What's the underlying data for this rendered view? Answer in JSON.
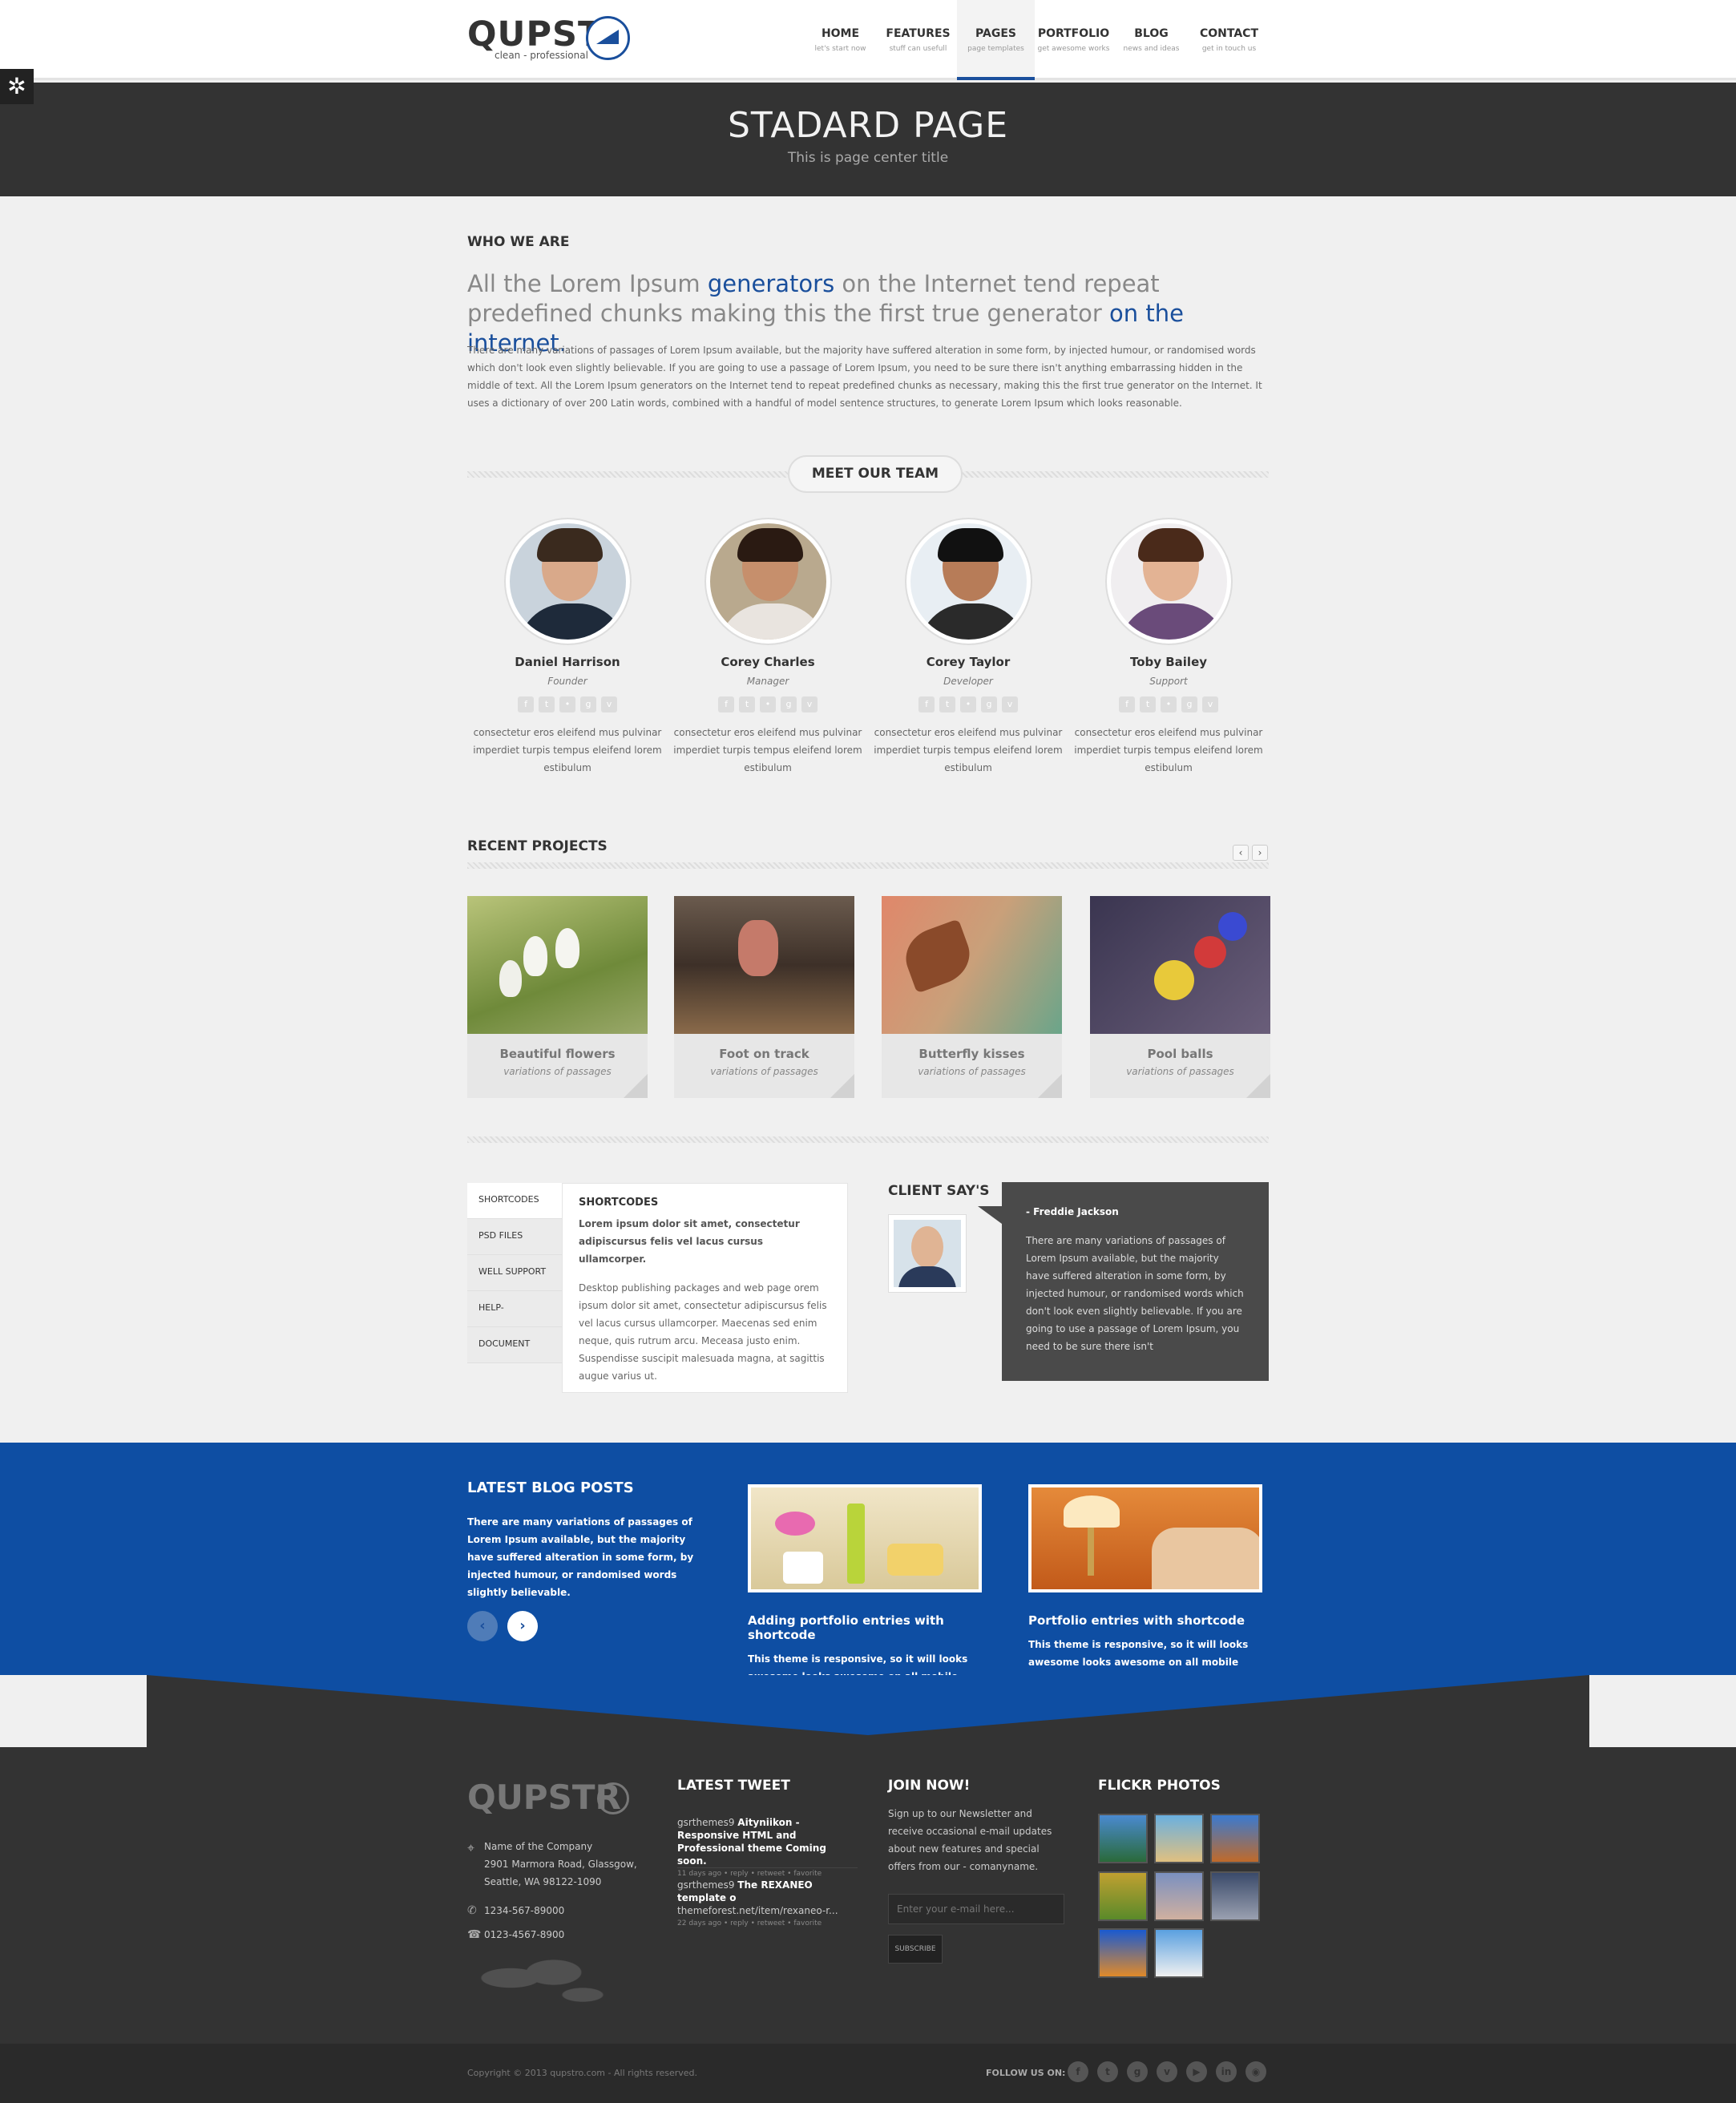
{
  "logo": {
    "word": "QUPSTR",
    "tagline": "clean - professional"
  },
  "nav": [
    {
      "label": "HOME",
      "sub": "let's start now"
    },
    {
      "label": "FEATURES",
      "sub": "stuff can usefull"
    },
    {
      "label": "PAGES",
      "sub": "page templates"
    },
    {
      "label": "PORTFOLIO",
      "sub": "get awesome works"
    },
    {
      "label": "BLOG",
      "sub": "news and ideas"
    },
    {
      "label": "CONTACT",
      "sub": "get in touch us"
    }
  ],
  "settings_icon": "gear-icon",
  "banner": {
    "title": "STADARD PAGE",
    "subtitle": "This is page center title"
  },
  "about": {
    "heading": "WHO WE ARE",
    "lead_1": "All the Lorem Ipsum ",
    "lead_hl1": "generators",
    "lead_2": " on the Internet tend repeat predefined chunks making this the first true generator ",
    "lead_hl2": "on the internet",
    "lead_3": ".",
    "paragraph": "There are many variations of passages of Lorem Ipsum available, but the majority have suffered alteration in some form, by injected humour, or randomised words which don't look even slightly believable. If you are going to use a passage of Lorem Ipsum, you need to be sure there isn't anything embarrassing hidden in the middle of text. All the Lorem Ipsum generators on the Internet tend to repeat predefined chunks as necessary, making this the first true generator on the Internet. It uses a dictionary of over 200 Latin words, combined with a handful of model sentence structures, to generate Lorem Ipsum which looks reasonable."
  },
  "team": {
    "heading": "MEET OUR TEAM",
    "members": [
      {
        "name": "Daniel Harrison",
        "role": "Founder",
        "desc": "consectetur eros eleifend mus pulvinar imperdiet turpis tempus eleifend lorem estibulum"
      },
      {
        "name": "Corey Charles",
        "role": "Manager",
        "desc": "consectetur eros eleifend mus pulvinar imperdiet turpis tempus eleifend lorem estibulum"
      },
      {
        "name": "Corey Taylor",
        "role": "Developer",
        "desc": "consectetur eros eleifend mus pulvinar imperdiet turpis tempus eleifend lorem estibulum"
      },
      {
        "name": "Toby Bailey",
        "role": "Support",
        "desc": "consectetur eros eleifend mus pulvinar imperdiet turpis tempus eleifend lorem estibulum"
      }
    ],
    "social_icons": [
      "facebook-icon",
      "twitter-icon",
      "flickr-icon",
      "google-plus-icon",
      "vimeo-icon"
    ]
  },
  "projects": {
    "heading": "RECENT PROJECTS",
    "prev": "‹",
    "next": "›",
    "items": [
      {
        "title": "Beautiful flowers",
        "sub": "variations of passages"
      },
      {
        "title": "Foot on track",
        "sub": "variations of passages"
      },
      {
        "title": "Butterfly kisses",
        "sub": "variations of passages"
      },
      {
        "title": "Pool balls",
        "sub": "variations of passages"
      }
    ]
  },
  "tabs": {
    "items": [
      "SHORTCODES",
      "PSD FILES",
      "WELL SUPPORT",
      "HELP-",
      "DOCUMENT"
    ],
    "content_title": "SHORTCODES",
    "content_bold": "Lorem ipsum dolor sit amet, consectetur adipiscursus felis vel lacus cursus ullamcorper.",
    "content_text": "Desktop publishing packages and web page orem ipsum dolor sit amet, consectetur adipiscursus felis vel lacus cursus ullamcorper. Maecenas sed enim neque, quis rutrum arcu. Meceasa justo enim. Suspendisse suscipit malesuada magna, at sagittis augue varius ut."
  },
  "client": {
    "heading": "CLIENT SAY'S",
    "author": "- Freddie Jackson",
    "quote": "There are many variations of passages of Lorem Ipsum available, but the majority have suffered alteration in some form, by injected humour, or randomised words which don't look even slightly believable. If you are going to use a passage of Lorem Ipsum, you need to be sure there isn't"
  },
  "blog": {
    "heading": "LATEST BLOG POSTS",
    "intro": "There are many variations of passages of Lorem Ipsum available, but the majority have suffered alteration in some form, by injected humour, or randomised words slightly believable.",
    "prev": "‹",
    "next": "›",
    "posts": [
      {
        "title": "Adding portfolio entries with shortcode",
        "desc": "This theme is responsive, so it will looks awesome looks awesome on all mobile devices."
      },
      {
        "title": "Portfolio entries with shortcode",
        "desc": "This theme is responsive, so it will looks awesome looks awesome on all mobile devices."
      }
    ]
  },
  "footer": {
    "logo": "QUPSTR",
    "company": "Name of the Company",
    "address1": "2901 Marmora Road, Glassgow,",
    "address2": "Seattle, WA 98122-1090",
    "phone": "1234-567-89000",
    "fax": "0123-4567-8900",
    "tweet_heading": "LATEST TWEET",
    "tweets": [
      {
        "user": "gsrthemes9",
        "text": "Aityniikon - Responsive HTML and Professional theme Coming soon.",
        "meta": "11 days ago • reply • retweet • favorite"
      },
      {
        "user": "gsrthemes9",
        "text": "The REXANEO template o",
        "link": "themeforest.net/item/rexaneo-r...",
        "meta": "22 days ago • reply • retweet • favorite"
      }
    ],
    "join_heading": "JOIN NOW!",
    "join_text": "Sign up to our Newsletter and receive occasional e-mail updates about new features and special offers from our - comanyname.",
    "email_placeholder": "Enter your e-mail here...",
    "subscribe": "SUBSCRIBE",
    "flickr_heading": "FLICKR PHOTOS",
    "copyright": "Copyright © 2013 qupstro.com - All rights reserved.",
    "follow": "FOLLOW US ON:",
    "follow_icons": [
      "facebook-icon",
      "twitter-icon",
      "google-plus-icon",
      "vimeo-icon",
      "youtube-icon",
      "linkedin-icon",
      "rss-icon"
    ]
  }
}
